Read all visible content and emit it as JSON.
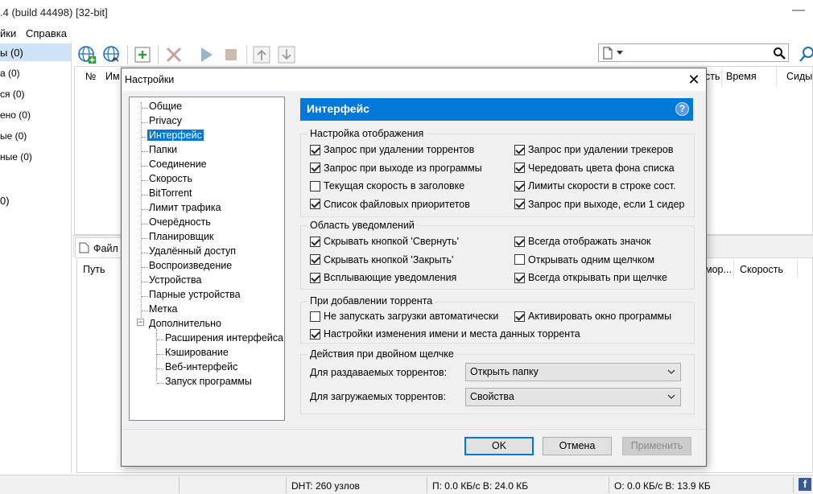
{
  "app": {
    "window_title": ".4  (build 44498) [32-bit]",
    "minimize_glyph": "—",
    "menu": [
      "йки",
      "Справка"
    ]
  },
  "sidebar": {
    "items": [
      "ы (0)",
      "а (0)",
      "ся (0)",
      "ено (0)",
      "ые (0)",
      "ные (0)",
      "0)"
    ]
  },
  "main_list": {
    "columns": [
      "№",
      "Им",
      "сть",
      "Время",
      "Сиды"
    ]
  },
  "lower": {
    "tab_label": "Файл",
    "columns": [
      "Путь",
      "мор...",
      "Скорость"
    ]
  },
  "status": {
    "dht": "DHT: 260 узлов",
    "download": "П: 0.0 КБ/с В: 24.0 КБ",
    "upload": "О: 0.0 КБ/с В: 13.9 КБ",
    "social_icon": "f"
  },
  "dialog": {
    "title": "Настройки",
    "close_glyph": "✕",
    "tree": [
      {
        "label": "Общие",
        "level": 1
      },
      {
        "label": "Privacy",
        "level": 1
      },
      {
        "label": "Интерфейс",
        "level": 1,
        "selected": true
      },
      {
        "label": "Папки",
        "level": 1
      },
      {
        "label": "Соединение",
        "level": 1
      },
      {
        "label": "Скорость",
        "level": 1
      },
      {
        "label": "BitTorrent",
        "level": 1
      },
      {
        "label": "Лимит трафика",
        "level": 1
      },
      {
        "label": "Очерёдность",
        "level": 1
      },
      {
        "label": "Планировщик",
        "level": 1
      },
      {
        "label": "Удалённый доступ",
        "level": 1
      },
      {
        "label": "Воспроизведение",
        "level": 1
      },
      {
        "label": "Устройства",
        "level": 1
      },
      {
        "label": "Парные устройства",
        "level": 1
      },
      {
        "label": "Метка",
        "level": 1
      },
      {
        "label": "Дополнительно",
        "level": 1,
        "expander": "−"
      },
      {
        "label": "Расширения интерфейса",
        "level": 2
      },
      {
        "label": "Кэширование",
        "level": 2
      },
      {
        "label": "Веб-интерфейс",
        "level": 2
      },
      {
        "label": "Запуск программы",
        "level": 2
      }
    ],
    "page_title": "Интерфейс",
    "help_glyph": "?",
    "display_group": {
      "label": "Настройка отображения",
      "left": [
        {
          "label": "Запрос при удалении торрентов",
          "checked": true
        },
        {
          "label": "Запрос при выходе из программы",
          "checked": true
        },
        {
          "label": "Текущая скорость в заголовке",
          "checked": false
        },
        {
          "label": "Список файловых приоритетов",
          "checked": true
        }
      ],
      "right": [
        {
          "label": "Запрос при удалении трекеров",
          "checked": true
        },
        {
          "label": "Чередовать цвета фона списка",
          "checked": true
        },
        {
          "label": "Лимиты скорости в строке сост.",
          "checked": true
        },
        {
          "label": "Запрос при выходе, если 1 сидер",
          "checked": true
        }
      ]
    },
    "notify_group": {
      "label": "Область уведомлений",
      "left": [
        {
          "label": "Скрывать кнопкой 'Свернуть'",
          "checked": true
        },
        {
          "label": "Скрывать кнопкой 'Закрыть'",
          "checked": true
        },
        {
          "label": "Всплывающие уведомления",
          "checked": true
        }
      ],
      "right": [
        {
          "label": "Всегда отображать значок",
          "checked": true
        },
        {
          "label": "Открывать одним щелчком",
          "checked": false
        },
        {
          "label": "Всегда открывать при щелчке",
          "checked": true
        }
      ]
    },
    "add_group": {
      "label": "При добавлении торрента",
      "items": [
        {
          "label": "Не запускать загрузки автоматически",
          "checked": false
        },
        {
          "label": "Активировать окно программы",
          "checked": true
        },
        {
          "label": "Настройки изменения имени и места данных торрента",
          "checked": true
        }
      ]
    },
    "dblclick_group": {
      "label": "Действия при двойном щелчке",
      "seeding_label": "Для раздаваемых торрентов:",
      "seeding_value": "Открыть папку",
      "downloading_label": "Для загружаемых торрентов:",
      "downloading_value": "Свойства"
    },
    "buttons": {
      "ok": "OK",
      "cancel": "Отмена",
      "apply": "Применить"
    }
  }
}
